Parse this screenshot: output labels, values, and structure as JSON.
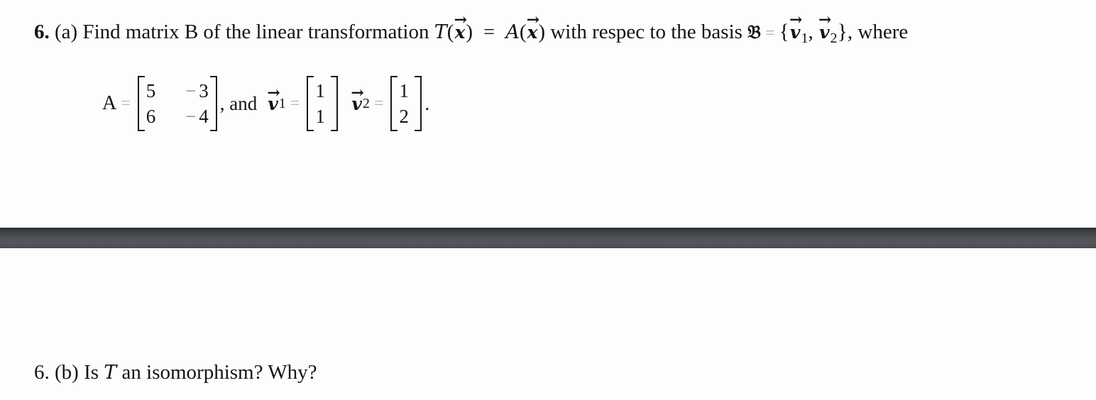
{
  "question_a": {
    "number": "6.",
    "text_before_T": "(a) Find matrix B of the linear transformation",
    "T_symbol": "T",
    "x_symbol": "x",
    "equals": "=",
    "A_symbol": "A",
    "text_after": "with respec to the basis",
    "basis_symbol": "𝔅",
    "brace_open": "{",
    "v_symbol": "v",
    "v1_sub": "1",
    "comma": ",",
    "v2_sub": "2",
    "brace_close": "}",
    "trailing": ", where"
  },
  "given": {
    "A_label": "A",
    "A_matrix": [
      [
        "5",
        "3"
      ],
      [
        "6",
        "4"
      ]
    ],
    "A_negatives": [
      [
        false,
        true
      ],
      [
        false,
        true
      ]
    ],
    "minus": "−",
    "and_text": ", and",
    "v_symbol": "v",
    "v1_sub": "1",
    "v1": [
      "1",
      "1"
    ],
    "v2_sub": "2",
    "v2": [
      "1",
      "2"
    ],
    "period": "."
  },
  "question_b": {
    "text_start": "6. (b) Is",
    "T_symbol": "T",
    "text_end": "an isomorphism? Why?"
  },
  "colors": {
    "text": "#141414",
    "divider": "#52555a",
    "background": "#fdfdfd"
  }
}
